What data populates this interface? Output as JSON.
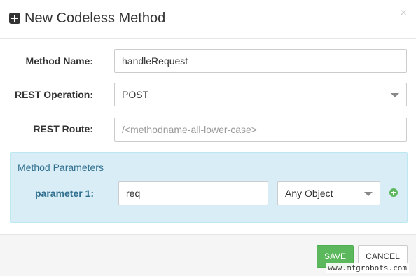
{
  "dialog": {
    "title": "New Codeless Method",
    "title_icon": "plus-square-icon",
    "close_symbol": "×"
  },
  "form": {
    "method_name": {
      "label": "Method Name:",
      "value": "handleRequest"
    },
    "rest_operation": {
      "label": "REST Operation:",
      "value": "POST"
    },
    "rest_route": {
      "label": "REST Route:",
      "value": "",
      "placeholder": "/<methodname-all-lower-case>"
    }
  },
  "parameters": {
    "title": "Method Parameters",
    "items": [
      {
        "label": "parameter 1:",
        "name": "req",
        "type": "Any Object"
      }
    ],
    "add_icon": "plus-circle-icon"
  },
  "footer": {
    "save_label": "SAVE",
    "cancel_label": "CANCEL"
  },
  "watermark": "www.mfgrobots.com",
  "colors": {
    "save": "#5cb85c",
    "panel_bg": "#d9edf7",
    "panel_text": "#31708f"
  }
}
